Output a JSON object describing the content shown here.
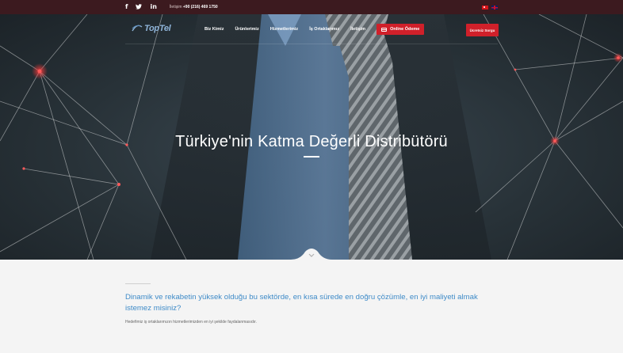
{
  "topbar": {
    "social": [
      {
        "name": "facebook-icon",
        "glyph": "f"
      },
      {
        "name": "twitter-icon",
        "glyph": "t"
      },
      {
        "name": "linkedin-icon",
        "glyph": "in"
      }
    ],
    "contact_label": "İletişim",
    "phone": "+90 (216) 469 1750",
    "languages": [
      "tr",
      "en"
    ]
  },
  "navbar": {
    "logo_text": "TopTel",
    "menu": [
      "Biz Kimiz",
      "Ürünlerimiz",
      "Hizmetlerimiz",
      "İş Ortaklarımız",
      "İletişim"
    ],
    "payment_button": "Online Ödeme",
    "quote_button": "Ücretsiz Sorgu"
  },
  "hero": {
    "title": "Türkiye'nin Katma Değerli Distribütörü"
  },
  "intro": {
    "tagline": "Dinamik ve rekabetin yüksek olduğu bu sektörde, en kısa sürede en doğru çözümle, en iyi maliyeti almak istemez misiniz?",
    "subtext": "Hedefimiz iş ortaklarımızın hizmetlerimizden en iyi şekilde faydalanmasıdır."
  },
  "colors": {
    "topbar": "#3c1a1f",
    "accent": "#d0202a",
    "tagline": "#3f8bc8",
    "logo": "#8fb4d8"
  }
}
